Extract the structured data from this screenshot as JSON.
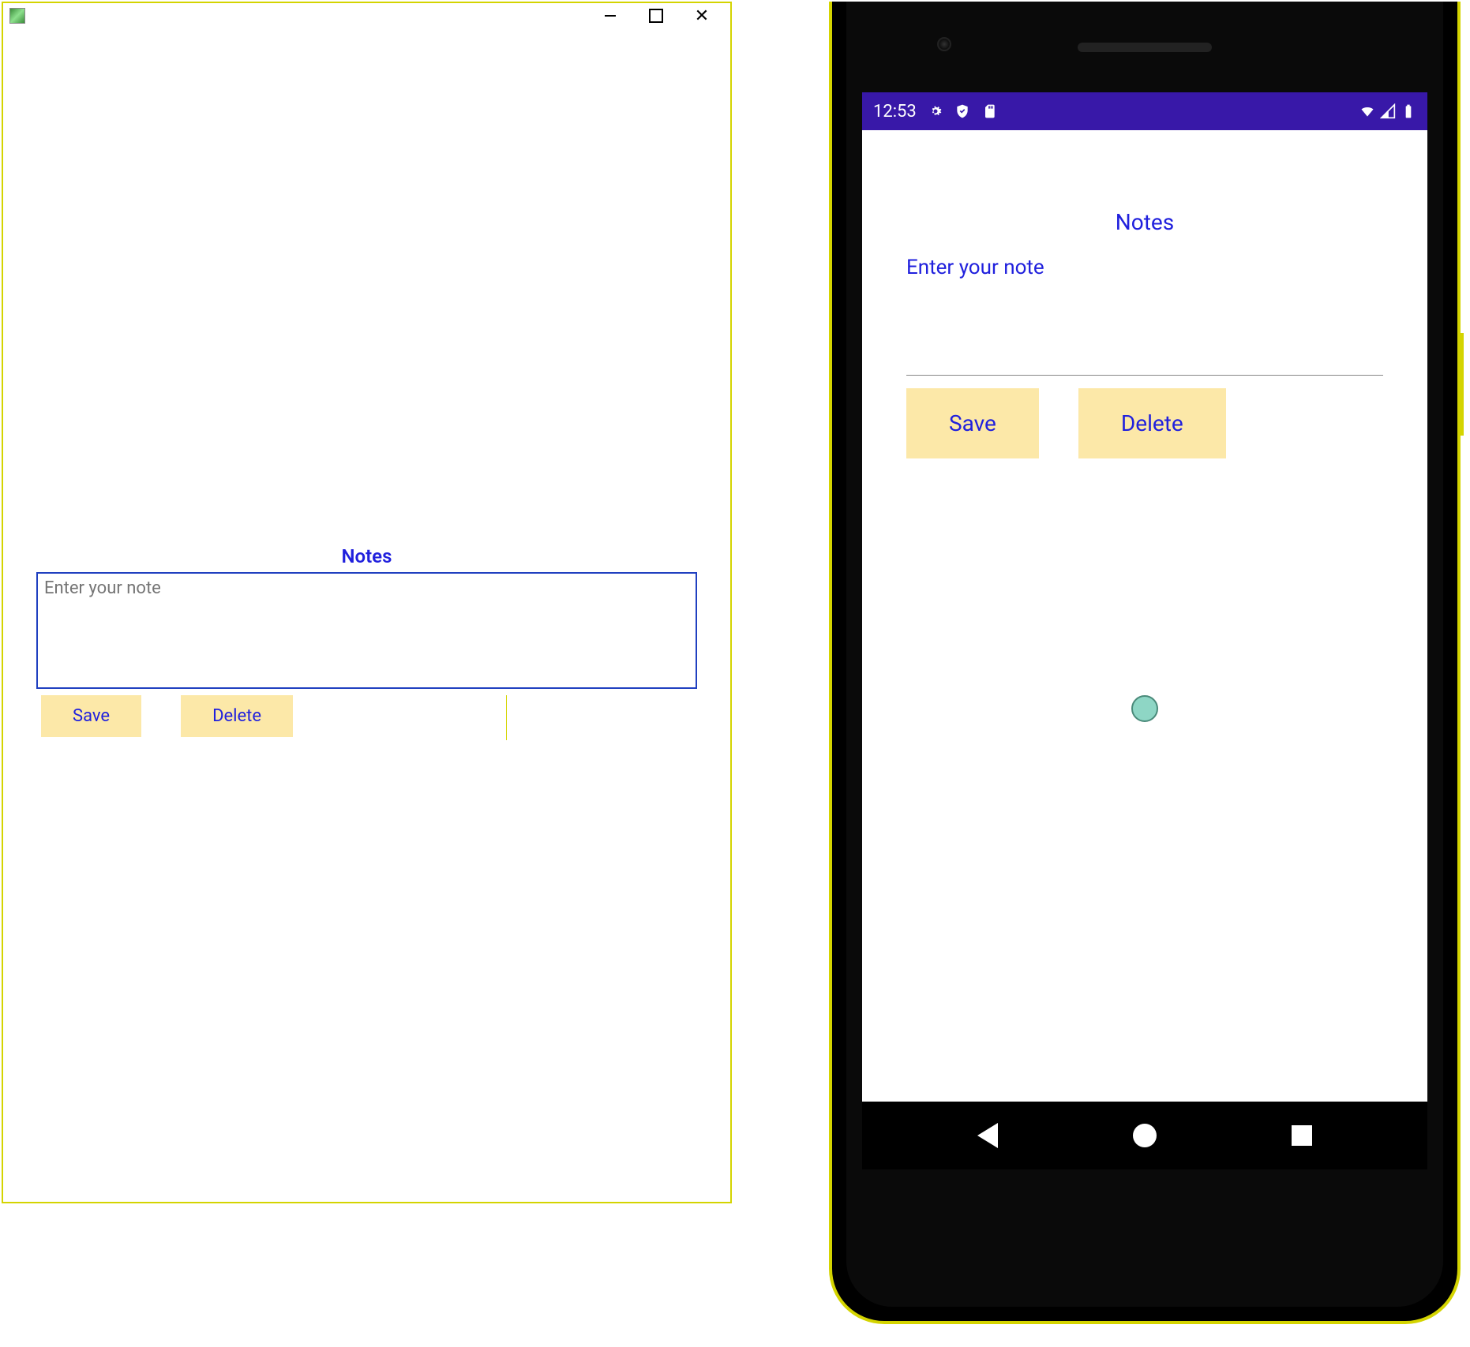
{
  "desktop": {
    "title": "Notes",
    "editor": {
      "placeholder": "Enter your note",
      "value": ""
    },
    "buttons": {
      "save": "Save",
      "delete": "Delete"
    }
  },
  "phone": {
    "statusbar": {
      "time": "12:53"
    },
    "title": "Notes",
    "editor": {
      "hint": "Enter your note",
      "value": ""
    },
    "buttons": {
      "save": "Save",
      "delete": "Delete"
    }
  }
}
